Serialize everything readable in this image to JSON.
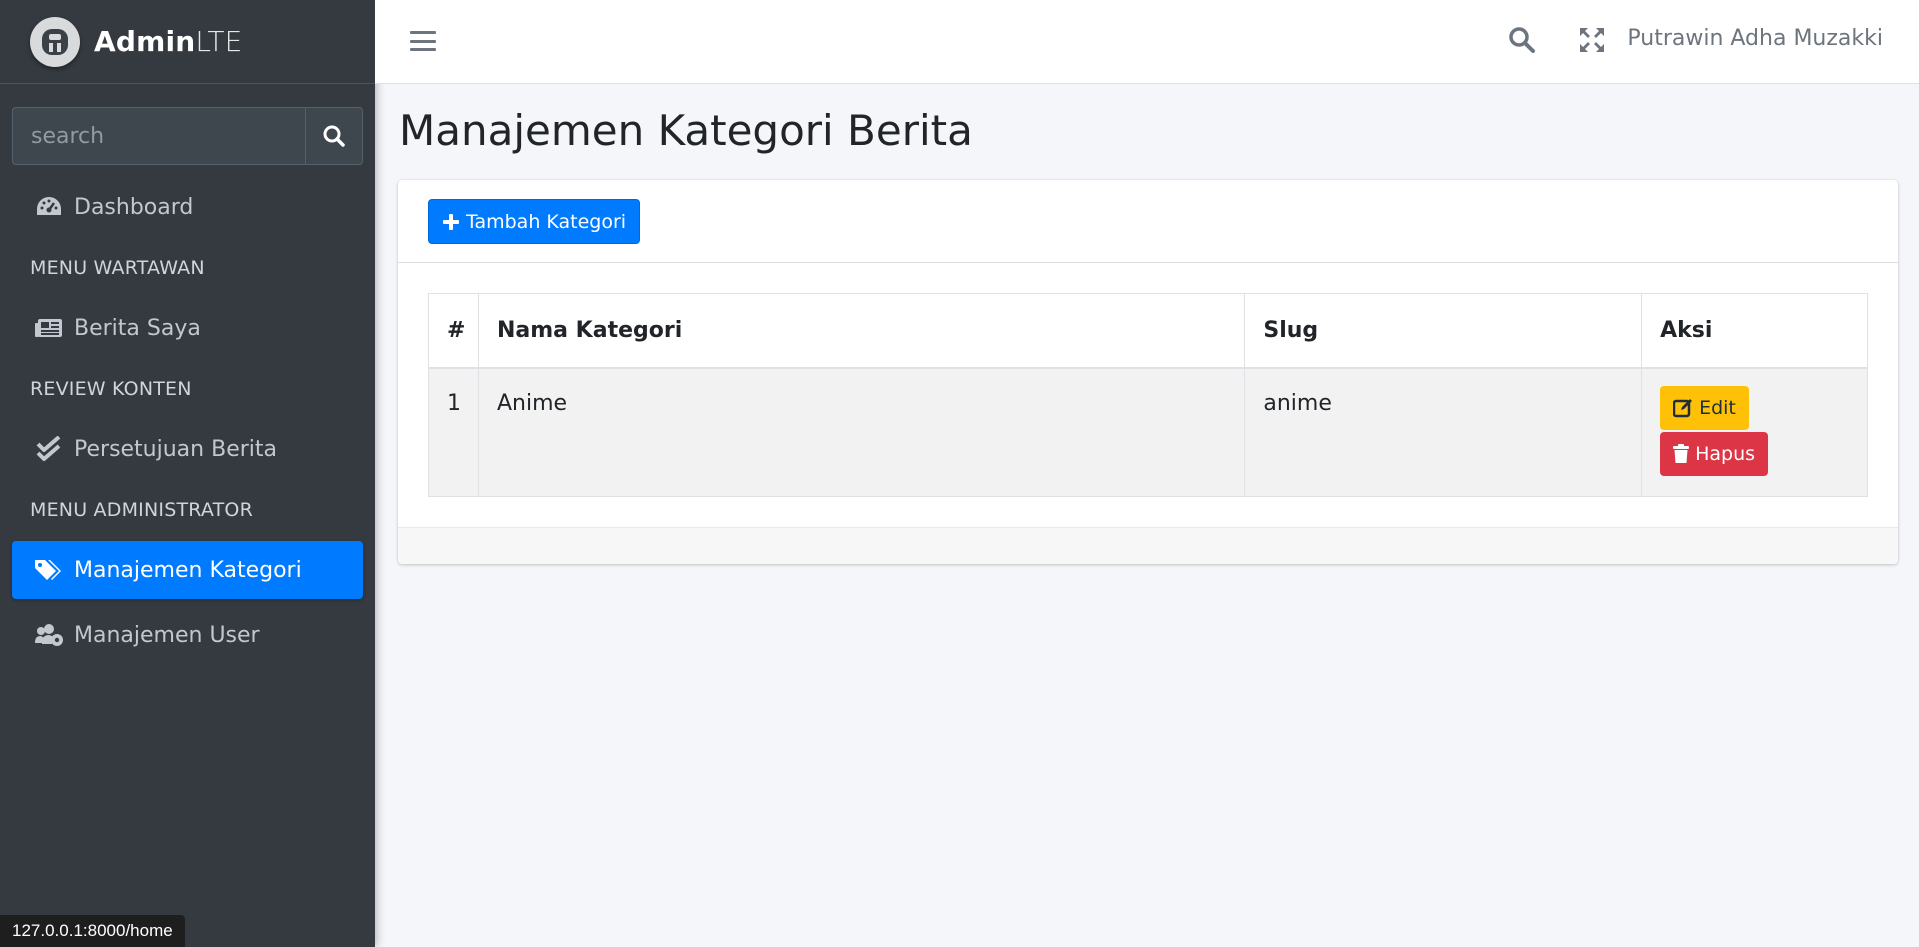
{
  "brand": {
    "name_bold": "Admin",
    "name_light": "LTE"
  },
  "sidebar": {
    "search_placeholder": "search",
    "items": [
      {
        "label": "Dashboard",
        "icon": "tachometer-icon"
      },
      {
        "label": "Berita Saya",
        "icon": "newspaper-icon"
      },
      {
        "label": "Persetujuan Berita",
        "icon": "check-double-icon"
      },
      {
        "label": "Manajemen Kategori",
        "icon": "tags-icon",
        "active": true
      },
      {
        "label": "Manajemen User",
        "icon": "users-cog-icon"
      }
    ],
    "headers": [
      "MENU WARTAWAN",
      "REVIEW KONTEN",
      "MENU ADMINISTRATOR"
    ]
  },
  "navbar": {
    "user_name": "Putrawin Adha Muzakki"
  },
  "page": {
    "title": "Manajemen Kategori Berita",
    "add_button": "Tambah Kategori"
  },
  "table": {
    "headers": [
      "#",
      "Nama Kategori",
      "Slug",
      "Aksi"
    ],
    "rows": [
      {
        "num": "1",
        "nama": "Anime",
        "slug": "anime",
        "edit_label": "Edit",
        "hapus_label": "Hapus"
      }
    ]
  },
  "status_bar": {
    "url": "127.0.0.1:8000/home"
  },
  "colors": {
    "primary": "#007bff",
    "warning": "#ffc107",
    "danger": "#dc3545",
    "sidebar": "#343a40"
  }
}
